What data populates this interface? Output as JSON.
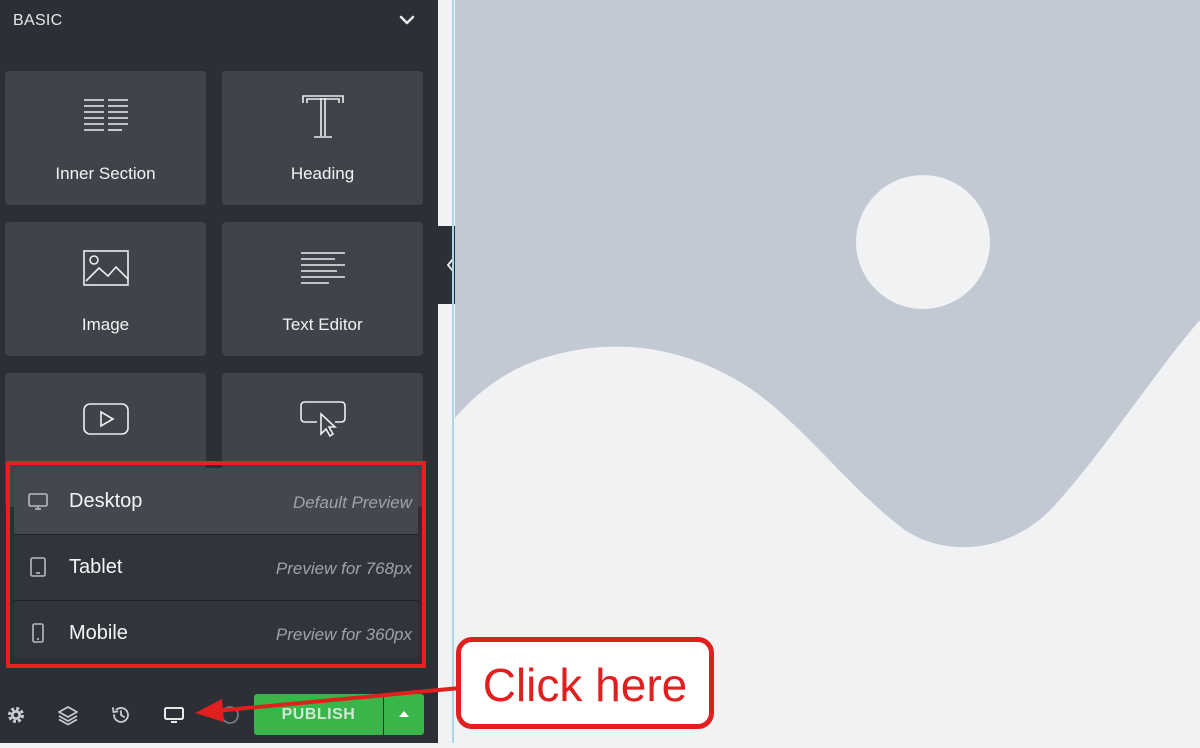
{
  "panel": {
    "section_title": "BASIC",
    "widgets": [
      {
        "label": "Inner Section",
        "icon": "inner-section-icon"
      },
      {
        "label": "Heading",
        "icon": "heading-icon"
      },
      {
        "label": "Image",
        "icon": "image-icon"
      },
      {
        "label": "Text Editor",
        "icon": "text-editor-icon"
      },
      {
        "label": "",
        "icon": "video-icon"
      },
      {
        "label": "",
        "icon": "button-icon"
      }
    ]
  },
  "responsive_menu": {
    "items": [
      {
        "name": "Desktop",
        "description": "Default Preview",
        "icon": "desktop-icon",
        "active": true
      },
      {
        "name": "Tablet",
        "description": "Preview for 768px",
        "icon": "tablet-icon",
        "active": false
      },
      {
        "name": "Mobile",
        "description": "Preview for 360px",
        "icon": "mobile-icon",
        "active": false
      }
    ]
  },
  "toolbar": {
    "publish_label": "PUBLISH",
    "icons": [
      "settings-icon",
      "navigator-icon",
      "history-icon",
      "responsive-mode-icon",
      "preview-icon"
    ]
  },
  "callout": {
    "text": "Click here"
  },
  "colors": {
    "panel_bg": "#2c2f35",
    "widget_bg": "#40434a",
    "publish_green": "#39b54a",
    "annotation_red": "#e21f1f",
    "placeholder_gray": "#c2c9d2"
  }
}
